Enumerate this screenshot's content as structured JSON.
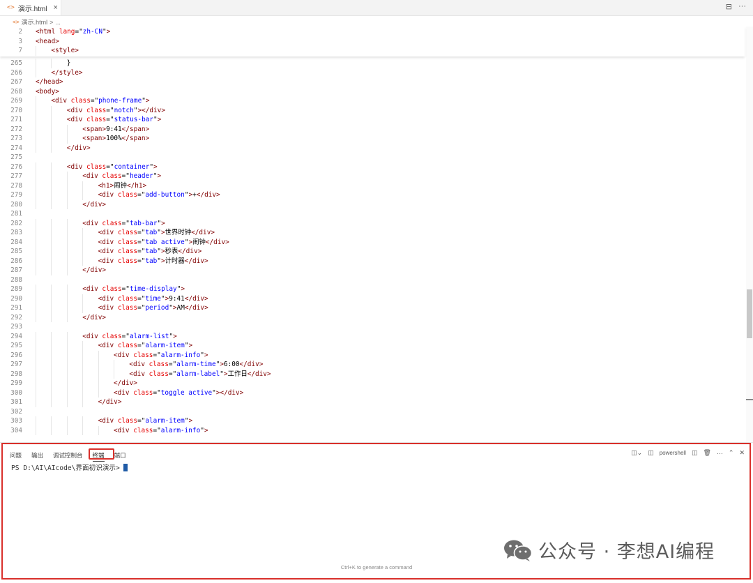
{
  "tab": {
    "icon": "<>",
    "filename": "演示.html",
    "close": "×"
  },
  "tab_actions": [
    "⊟",
    "···"
  ],
  "breadcrumb": {
    "icon": "<>",
    "file": "演示.html",
    "separator": ">",
    "rest": "..."
  },
  "sticky_lines": [
    {
      "n": "2",
      "indent": 0,
      "tokens": [
        [
          "t",
          "<html "
        ],
        [
          "a",
          "lang"
        ],
        [
          "p",
          "=\""
        ],
        [
          "v",
          "zh-CN"
        ],
        [
          "p",
          "\""
        ],
        [
          "t",
          ">"
        ]
      ]
    },
    {
      "n": "3",
      "indent": 0,
      "tokens": [
        [
          "t",
          "<head>"
        ]
      ]
    },
    {
      "n": "7",
      "indent": 1,
      "tokens": [
        [
          "t",
          "<style>"
        ]
      ]
    }
  ],
  "code_lines": [
    {
      "n": "265",
      "indent": 2,
      "tokens": [
        [
          "p",
          "}"
        ]
      ]
    },
    {
      "n": "266",
      "indent": 1,
      "tokens": [
        [
          "t",
          "</style>"
        ]
      ]
    },
    {
      "n": "267",
      "indent": 0,
      "tokens": [
        [
          "t",
          "</head>"
        ]
      ]
    },
    {
      "n": "268",
      "indent": 0,
      "tokens": [
        [
          "t",
          "<body>"
        ]
      ]
    },
    {
      "n": "269",
      "indent": 1,
      "tokens": [
        [
          "t",
          "<div "
        ],
        [
          "a",
          "class"
        ],
        [
          "p",
          "=\""
        ],
        [
          "v",
          "phone-frame"
        ],
        [
          "p",
          "\""
        ],
        [
          "t",
          ">"
        ]
      ]
    },
    {
      "n": "270",
      "indent": 2,
      "tokens": [
        [
          "t",
          "<div "
        ],
        [
          "a",
          "class"
        ],
        [
          "p",
          "=\""
        ],
        [
          "v",
          "notch"
        ],
        [
          "p",
          "\""
        ],
        [
          "t",
          "></div>"
        ]
      ]
    },
    {
      "n": "271",
      "indent": 2,
      "tokens": [
        [
          "t",
          "<div "
        ],
        [
          "a",
          "class"
        ],
        [
          "p",
          "=\""
        ],
        [
          "v",
          "status-bar"
        ],
        [
          "p",
          "\""
        ],
        [
          "t",
          ">"
        ]
      ]
    },
    {
      "n": "272",
      "indent": 3,
      "tokens": [
        [
          "t",
          "<span>"
        ],
        [
          "p",
          "9:41"
        ],
        [
          "t",
          "</span>"
        ]
      ]
    },
    {
      "n": "273",
      "indent": 3,
      "tokens": [
        [
          "t",
          "<span>"
        ],
        [
          "p",
          "100%"
        ],
        [
          "t",
          "</span>"
        ]
      ]
    },
    {
      "n": "274",
      "indent": 2,
      "tokens": [
        [
          "t",
          "</div>"
        ]
      ]
    },
    {
      "n": "275",
      "indent": 0,
      "tokens": []
    },
    {
      "n": "276",
      "indent": 2,
      "tokens": [
        [
          "t",
          "<div "
        ],
        [
          "a",
          "class"
        ],
        [
          "p",
          "=\""
        ],
        [
          "v",
          "container"
        ],
        [
          "p",
          "\""
        ],
        [
          "t",
          ">"
        ]
      ]
    },
    {
      "n": "277",
      "indent": 3,
      "tokens": [
        [
          "t",
          "<div "
        ],
        [
          "a",
          "class"
        ],
        [
          "p",
          "=\""
        ],
        [
          "v",
          "header"
        ],
        [
          "p",
          "\""
        ],
        [
          "t",
          ">"
        ]
      ]
    },
    {
      "n": "278",
      "indent": 4,
      "tokens": [
        [
          "t",
          "<h1>"
        ],
        [
          "p",
          "闹钟"
        ],
        [
          "t",
          "</h1>"
        ]
      ]
    },
    {
      "n": "279",
      "indent": 4,
      "tokens": [
        [
          "t",
          "<div "
        ],
        [
          "a",
          "class"
        ],
        [
          "p",
          "=\""
        ],
        [
          "v",
          "add-button"
        ],
        [
          "p",
          "\""
        ],
        [
          "t",
          ">"
        ],
        [
          "p",
          "+"
        ],
        [
          "t",
          "</div>"
        ]
      ]
    },
    {
      "n": "280",
      "indent": 3,
      "tokens": [
        [
          "t",
          "</div>"
        ]
      ]
    },
    {
      "n": "281",
      "indent": 0,
      "tokens": []
    },
    {
      "n": "282",
      "indent": 3,
      "tokens": [
        [
          "t",
          "<div "
        ],
        [
          "a",
          "class"
        ],
        [
          "p",
          "=\""
        ],
        [
          "v",
          "tab-bar"
        ],
        [
          "p",
          "\""
        ],
        [
          "t",
          ">"
        ]
      ]
    },
    {
      "n": "283",
      "indent": 4,
      "tokens": [
        [
          "t",
          "<div "
        ],
        [
          "a",
          "class"
        ],
        [
          "p",
          "=\""
        ],
        [
          "v",
          "tab"
        ],
        [
          "p",
          "\""
        ],
        [
          "t",
          ">"
        ],
        [
          "p",
          "世界时钟"
        ],
        [
          "t",
          "</div>"
        ]
      ]
    },
    {
      "n": "284",
      "indent": 4,
      "tokens": [
        [
          "t",
          "<div "
        ],
        [
          "a",
          "class"
        ],
        [
          "p",
          "=\""
        ],
        [
          "v",
          "tab active"
        ],
        [
          "p",
          "\""
        ],
        [
          "t",
          ">"
        ],
        [
          "p",
          "闹钟"
        ],
        [
          "t",
          "</div>"
        ]
      ]
    },
    {
      "n": "285",
      "indent": 4,
      "tokens": [
        [
          "t",
          "<div "
        ],
        [
          "a",
          "class"
        ],
        [
          "p",
          "=\""
        ],
        [
          "v",
          "tab"
        ],
        [
          "p",
          "\""
        ],
        [
          "t",
          ">"
        ],
        [
          "p",
          "秒表"
        ],
        [
          "t",
          "</div>"
        ]
      ]
    },
    {
      "n": "286",
      "indent": 4,
      "tokens": [
        [
          "t",
          "<div "
        ],
        [
          "a",
          "class"
        ],
        [
          "p",
          "=\""
        ],
        [
          "v",
          "tab"
        ],
        [
          "p",
          "\""
        ],
        [
          "t",
          ">"
        ],
        [
          "p",
          "计时器"
        ],
        [
          "t",
          "</div>"
        ]
      ]
    },
    {
      "n": "287",
      "indent": 3,
      "tokens": [
        [
          "t",
          "</div>"
        ]
      ]
    },
    {
      "n": "288",
      "indent": 0,
      "tokens": []
    },
    {
      "n": "289",
      "indent": 3,
      "tokens": [
        [
          "t",
          "<div "
        ],
        [
          "a",
          "class"
        ],
        [
          "p",
          "=\""
        ],
        [
          "v",
          "time-display"
        ],
        [
          "p",
          "\""
        ],
        [
          "t",
          ">"
        ]
      ]
    },
    {
      "n": "290",
      "indent": 4,
      "tokens": [
        [
          "t",
          "<div "
        ],
        [
          "a",
          "class"
        ],
        [
          "p",
          "=\""
        ],
        [
          "v",
          "time"
        ],
        [
          "p",
          "\""
        ],
        [
          "t",
          ">"
        ],
        [
          "p",
          "9:41"
        ],
        [
          "t",
          "</div>"
        ]
      ]
    },
    {
      "n": "291",
      "indent": 4,
      "tokens": [
        [
          "t",
          "<div "
        ],
        [
          "a",
          "class"
        ],
        [
          "p",
          "=\""
        ],
        [
          "v",
          "period"
        ],
        [
          "p",
          "\""
        ],
        [
          "t",
          ">"
        ],
        [
          "p",
          "AM"
        ],
        [
          "t",
          "</div>"
        ]
      ]
    },
    {
      "n": "292",
      "indent": 3,
      "tokens": [
        [
          "t",
          "</div>"
        ]
      ]
    },
    {
      "n": "293",
      "indent": 0,
      "tokens": []
    },
    {
      "n": "294",
      "indent": 3,
      "tokens": [
        [
          "t",
          "<div "
        ],
        [
          "a",
          "class"
        ],
        [
          "p",
          "=\""
        ],
        [
          "v",
          "alarm-list"
        ],
        [
          "p",
          "\""
        ],
        [
          "t",
          ">"
        ]
      ]
    },
    {
      "n": "295",
      "indent": 4,
      "tokens": [
        [
          "t",
          "<div "
        ],
        [
          "a",
          "class"
        ],
        [
          "p",
          "=\""
        ],
        [
          "v",
          "alarm-item"
        ],
        [
          "p",
          "\""
        ],
        [
          "t",
          ">"
        ]
      ]
    },
    {
      "n": "296",
      "indent": 5,
      "tokens": [
        [
          "t",
          "<div "
        ],
        [
          "a",
          "class"
        ],
        [
          "p",
          "=\""
        ],
        [
          "v",
          "alarm-info"
        ],
        [
          "p",
          "\""
        ],
        [
          "t",
          ">"
        ]
      ]
    },
    {
      "n": "297",
      "indent": 6,
      "tokens": [
        [
          "t",
          "<div "
        ],
        [
          "a",
          "class"
        ],
        [
          "p",
          "=\""
        ],
        [
          "v",
          "alarm-time"
        ],
        [
          "p",
          "\""
        ],
        [
          "t",
          ">"
        ],
        [
          "p",
          "6:00"
        ],
        [
          "t",
          "</div>"
        ]
      ]
    },
    {
      "n": "298",
      "indent": 6,
      "tokens": [
        [
          "t",
          "<div "
        ],
        [
          "a",
          "class"
        ],
        [
          "p",
          "=\""
        ],
        [
          "v",
          "alarm-label"
        ],
        [
          "p",
          "\""
        ],
        [
          "t",
          ">"
        ],
        [
          "p",
          "工作日"
        ],
        [
          "t",
          "</div>"
        ]
      ]
    },
    {
      "n": "299",
      "indent": 5,
      "tokens": [
        [
          "t",
          "</div>"
        ]
      ]
    },
    {
      "n": "300",
      "indent": 5,
      "tokens": [
        [
          "t",
          "<div "
        ],
        [
          "a",
          "class"
        ],
        [
          "p",
          "=\""
        ],
        [
          "v",
          "toggle active"
        ],
        [
          "p",
          "\""
        ],
        [
          "t",
          "></div>"
        ]
      ]
    },
    {
      "n": "301",
      "indent": 4,
      "tokens": [
        [
          "t",
          "</div>"
        ]
      ]
    },
    {
      "n": "302",
      "indent": 0,
      "tokens": []
    },
    {
      "n": "303",
      "indent": 4,
      "tokens": [
        [
          "t",
          "<div "
        ],
        [
          "a",
          "class"
        ],
        [
          "p",
          "=\""
        ],
        [
          "v",
          "alarm-item"
        ],
        [
          "p",
          "\""
        ],
        [
          "t",
          ">"
        ]
      ]
    },
    {
      "n": "304",
      "indent": 5,
      "tokens": [
        [
          "t",
          "<div "
        ],
        [
          "a",
          "class"
        ],
        [
          "p",
          "=\""
        ],
        [
          "v",
          "alarm-info"
        ],
        [
          "p",
          "\""
        ],
        [
          "t",
          ">"
        ]
      ]
    }
  ],
  "panel": {
    "tabs": [
      "问题",
      "输出",
      "调试控制台",
      "终端",
      "端口"
    ],
    "active_tab": "终端",
    "shell_name": "powershell",
    "prompt": "PS D:\\AI\\AIcode\\界面初识演示>",
    "hint": "Ctrl+K to generate a command"
  },
  "watermark": {
    "text": "公众号 · 李想AI编程"
  },
  "colors": {
    "tag": "#800000",
    "attr": "#e50000",
    "value": "#0000ff",
    "plain": "#000000",
    "highlight": "#d9302b"
  }
}
